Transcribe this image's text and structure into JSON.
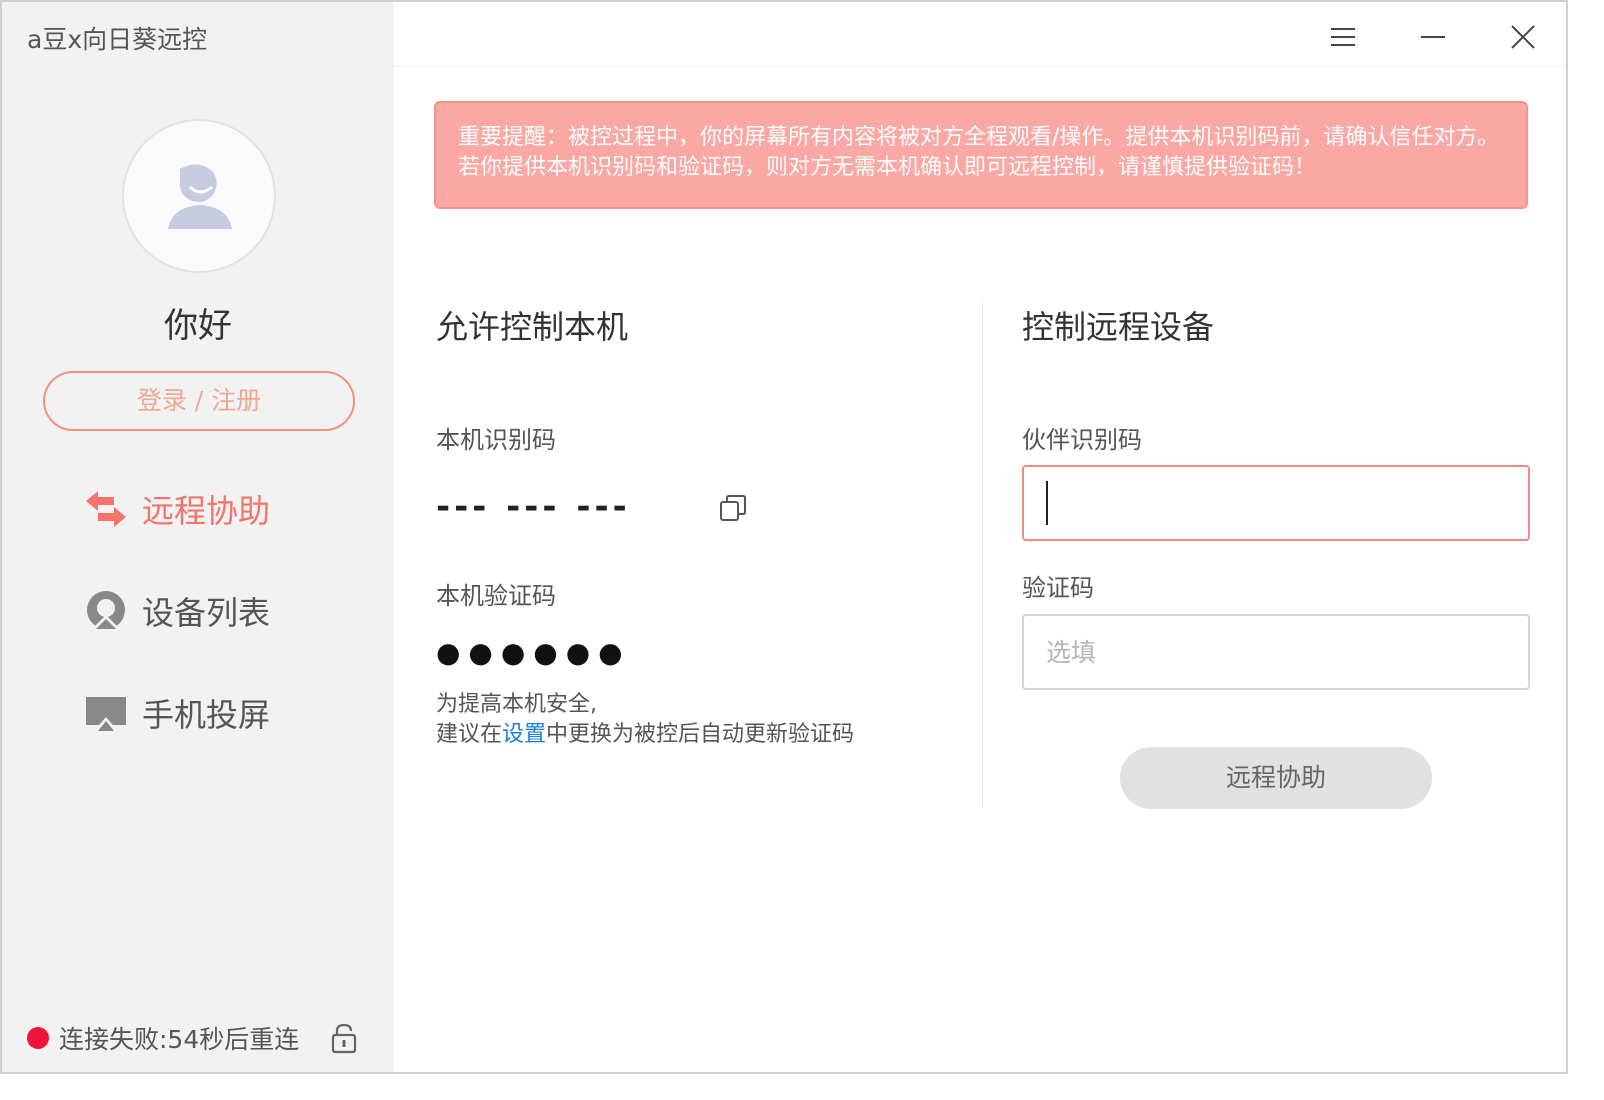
{
  "app": {
    "title": "a豆x向日葵远控"
  },
  "sidebar": {
    "greeting": "你好",
    "login_label": "登录 / 注册",
    "nav": [
      {
        "label": "远程协助",
        "icon": "remote-assist-icon",
        "active": true
      },
      {
        "label": "设备列表",
        "icon": "device-list-icon",
        "active": false
      },
      {
        "label": "手机投屏",
        "icon": "screen-mirror-icon",
        "active": false
      }
    ],
    "status": {
      "text": "连接失败:54秒后重连",
      "color": "#f0143c"
    }
  },
  "warning": {
    "text": "重要提醒：被控过程中，你的屏幕所有内容将被对方全程观看/操作。提供本机识别码前，请确认信任对方。若你提供本机识别码和验证码，则对方无需本机确认即可远程控制，请谨慎提供验证码！"
  },
  "allow_control": {
    "title": "允许控制本机",
    "id_label": "本机识别码",
    "id_value": "--- --- ---",
    "code_label": "本机验证码",
    "code_value": "●●●●●●",
    "hint_line1": "为提高本机安全,",
    "hint_prefix": "建议在",
    "hint_link": "设置",
    "hint_suffix": "中更换为被控后自动更新验证码"
  },
  "remote_control": {
    "title": "控制远程设备",
    "partner_label": "伙伴识别码",
    "partner_value": "",
    "code_label": "验证码",
    "code_placeholder": "选填",
    "button_label": "远程协助"
  },
  "colors": {
    "accent": "#f4736a",
    "warning_bg": "#fba7a3",
    "link": "#1b7fd4"
  }
}
